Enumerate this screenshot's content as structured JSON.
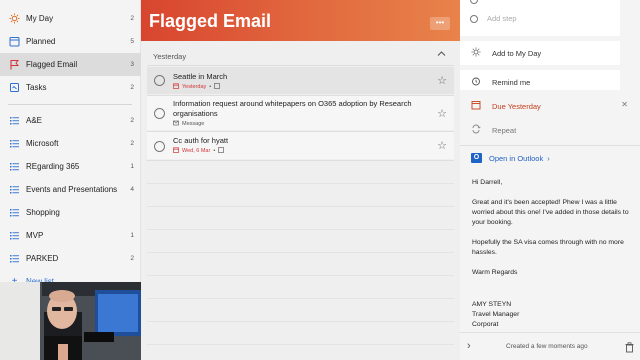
{
  "sidebar": {
    "items": [
      {
        "label": "My Day",
        "count": "2",
        "icon": "sun-icon",
        "name": "sidebar-item-my-day"
      },
      {
        "label": "Planned",
        "count": "5",
        "icon": "calendar-icon",
        "name": "sidebar-item-planned"
      },
      {
        "label": "Flagged Email",
        "count": "3",
        "icon": "flag-icon",
        "name": "sidebar-item-flagged-email"
      },
      {
        "label": "Tasks",
        "count": "2",
        "icon": "home-icon",
        "name": "sidebar-item-tasks"
      },
      {
        "label": "A&E",
        "count": "2",
        "icon": "list-icon",
        "name": "sidebar-item-ae"
      },
      {
        "label": "Microsoft",
        "count": "2",
        "icon": "list-icon",
        "name": "sidebar-item-microsoft"
      },
      {
        "label": "REgarding 365",
        "count": "1",
        "icon": "list-icon",
        "name": "sidebar-item-regarding-365"
      },
      {
        "label": "Events and Presentations",
        "count": "4",
        "icon": "list-icon",
        "name": "sidebar-item-events"
      },
      {
        "label": "Shopping",
        "count": "",
        "icon": "list-icon",
        "name": "sidebar-item-shopping"
      },
      {
        "label": "MVP",
        "count": "1",
        "icon": "list-icon",
        "name": "sidebar-item-mvp"
      },
      {
        "label": "PARKED",
        "count": "2",
        "icon": "list-icon",
        "name": "sidebar-item-parked"
      }
    ],
    "partial_label": "New list"
  },
  "main": {
    "title": "Flagged Email",
    "section": "Yesterday",
    "tasks": [
      {
        "title": "Seattle in March",
        "due": "Yesterday",
        "tag": ""
      },
      {
        "title": "Information request around whitepapers on O365 adoption by Research organisations",
        "due": "",
        "tag": "Message"
      },
      {
        "title": "Cc auth for hyatt",
        "due": "Wed, 6 Mar",
        "tag": ""
      }
    ]
  },
  "detail": {
    "add_step_placeholder": "Add step",
    "add_to_my_day": "Add to My Day",
    "remind_me": "Remind me",
    "due": "Due Yesterday",
    "repeat": "Repeat",
    "open_in_outlook": "Open in Outlook",
    "note": {
      "greeting": "Hi Darrell,",
      "p1": "Great and it's been accepted!  Phew I was a little worried about this one!  I've added in those details to your booking.",
      "p2": "Hopefully the SA visa comes through with no more hassles.",
      "closing": "Warm Regards",
      "sig_name": "AMY STEYN",
      "sig_title": "Travel Manager",
      "sig_company": "Corporat"
    },
    "created": "Created a few moments ago"
  },
  "colors": {
    "header_start": "#d8452f",
    "header_end": "#e8834a",
    "due_red": "#d13438",
    "outlook_blue": "#2563c4",
    "flag_red": "#d13438",
    "list_blue": "#2f6fcf"
  }
}
